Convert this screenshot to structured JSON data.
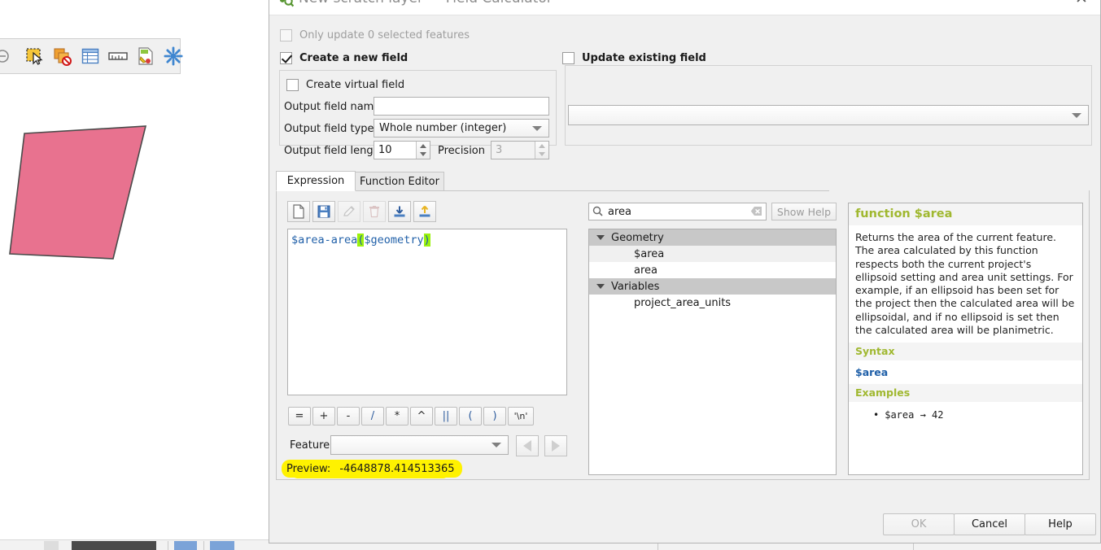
{
  "dialog": {
    "title": "New scratch layer — Field Calculator",
    "title_icon": "qgis-logo-icon",
    "close_label": "✕",
    "only_update_label": "Only update 0 selected features",
    "create_new_field_label": "Create a new field",
    "update_existing_field_label": "Update existing field",
    "create_virtual_field_label": "Create virtual field",
    "output_field_name_label": "Output field name",
    "output_field_name_value": "",
    "output_field_name_placeholder": "",
    "output_field_type_label": "Output field type",
    "output_field_type_value": "Whole number (integer)",
    "output_field_length_label": "Output field length",
    "output_field_length_value": "10",
    "precision_label": "Precision",
    "precision_value": "3",
    "update_field_combo_value": ""
  },
  "tabs": [
    {
      "label": "Expression",
      "active": true
    },
    {
      "label": "Function Editor",
      "active": false
    }
  ],
  "expression_toolbar": [
    {
      "name": "new-expression-icon",
      "enabled": true
    },
    {
      "name": "save-expression-icon",
      "enabled": true
    },
    {
      "name": "edit-expression-icon",
      "enabled": false
    },
    {
      "name": "delete-expression-icon",
      "enabled": false
    },
    {
      "name": "import-expressions-icon",
      "enabled": true
    },
    {
      "name": "export-expressions-icon",
      "enabled": true
    }
  ],
  "expression": {
    "prefix": "$area-area",
    "open_paren": "(",
    "inner": "$geometry",
    "close_paren": ")",
    "full_text": "$area-area($geometry)"
  },
  "operators": [
    "=",
    "+",
    "-",
    "/",
    "*",
    "^",
    "||",
    "(",
    ")",
    "'\\n'"
  ],
  "feature": {
    "label": "Feature",
    "value": "",
    "prev_label": "◀",
    "next_label": "▶"
  },
  "preview": {
    "label": "Preview:",
    "value": "-4648878.414513365",
    "highlight_color": "#fff200"
  },
  "search": {
    "value": "area",
    "placeholder": "",
    "icon": "search-icon",
    "clear_icon": "clear-icon",
    "show_help_label": "Show Help"
  },
  "function_tree": [
    {
      "label": "Geometry",
      "type": "group",
      "expanded": true,
      "indent": 0,
      "selected": false
    },
    {
      "label": "$area",
      "type": "item",
      "indent": 1,
      "selected": true
    },
    {
      "label": "area",
      "type": "item",
      "indent": 1,
      "selected": false
    },
    {
      "label": "Variables",
      "type": "group",
      "expanded": true,
      "indent": 0,
      "selected": false
    },
    {
      "label": "project_area_units",
      "type": "item",
      "indent": 1,
      "selected": false
    }
  ],
  "help": {
    "title": "function $area",
    "body": "Returns the area of the current feature. The area calculated by this function respects both the current project's ellipsoid setting and area unit settings. For example, if an ellipsoid has been set for the project then the calculated area will be ellipsoidal, and if no ellipsoid is set then the calculated area will be planimetric.",
    "syntax_heading": "Syntax",
    "syntax_value": "$area",
    "examples_heading": "Examples",
    "example_1": "$area → 42"
  },
  "dialog_buttons": [
    {
      "label": "OK",
      "enabled": false
    },
    {
      "label": "Cancel",
      "enabled": true
    },
    {
      "label": "Help",
      "enabled": true
    }
  ],
  "background": {
    "toolbar_icons": [
      "deselect-features-icon",
      "select-features-by-area-icon",
      "deselect-all-layers-icon",
      "open-attribute-table-icon",
      "measure-line-icon",
      "field-calculator-icon",
      "processing-toolbox-icon"
    ],
    "polygon_fill": "#e8728f",
    "polygon_stroke": "#4a4a4a"
  }
}
